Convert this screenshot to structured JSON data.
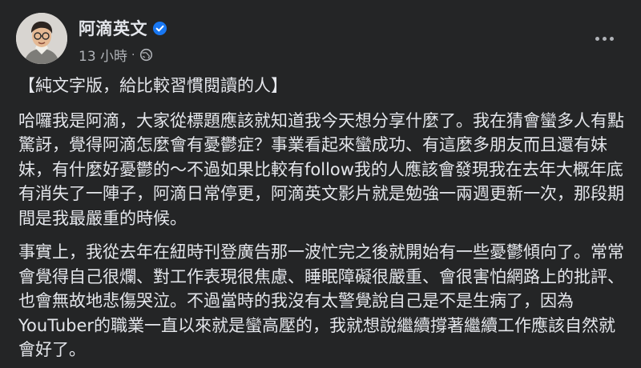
{
  "post": {
    "author_name": "阿滴英文",
    "timestamp": "13 小時",
    "separator": "·",
    "privacy_icon": "globe-icon",
    "verified_icon": "verified-badge-icon",
    "more_icon": "more-options-icon",
    "paragraphs": [
      "【純文字版，給比較習慣閱讀的人】",
      "哈囉我是阿滴，大家從標題應該就知道我今天想分享什麼了。我在猜會蠻多人有點驚訝，覺得阿滴怎麼會有憂鬱症？事業看起來蠻成功、有這麼多朋友而且還有妹妹，有什麼好憂鬱的～不過如果比較有follow我的人應該會發現我在去年大概年底有消失了一陣子，阿滴日常停更，阿滴英文影片就是勉強一兩週更新一次，那段期間是我最嚴重的時候。",
      "事實上，我從去年在紐時刊登廣告那一波忙完之後就開始有一些憂鬱傾向了。常常會覺得自己很爛、對工作表現很焦慮、睡眠障礙很嚴重、會很害怕網路上的批評、 也會無故地悲傷哭泣。不過當時的我沒有太警覺說自己是不是生病了，因為YouTuber的職業一直以來就是蠻高壓的，我就想說繼續撐著繼續工作應該自然就會好了。"
    ]
  },
  "colors": {
    "background": "#242526",
    "primary_text": "#e4e6eb",
    "secondary_text": "#b0b3b8",
    "verified_blue": "#1877f2"
  }
}
